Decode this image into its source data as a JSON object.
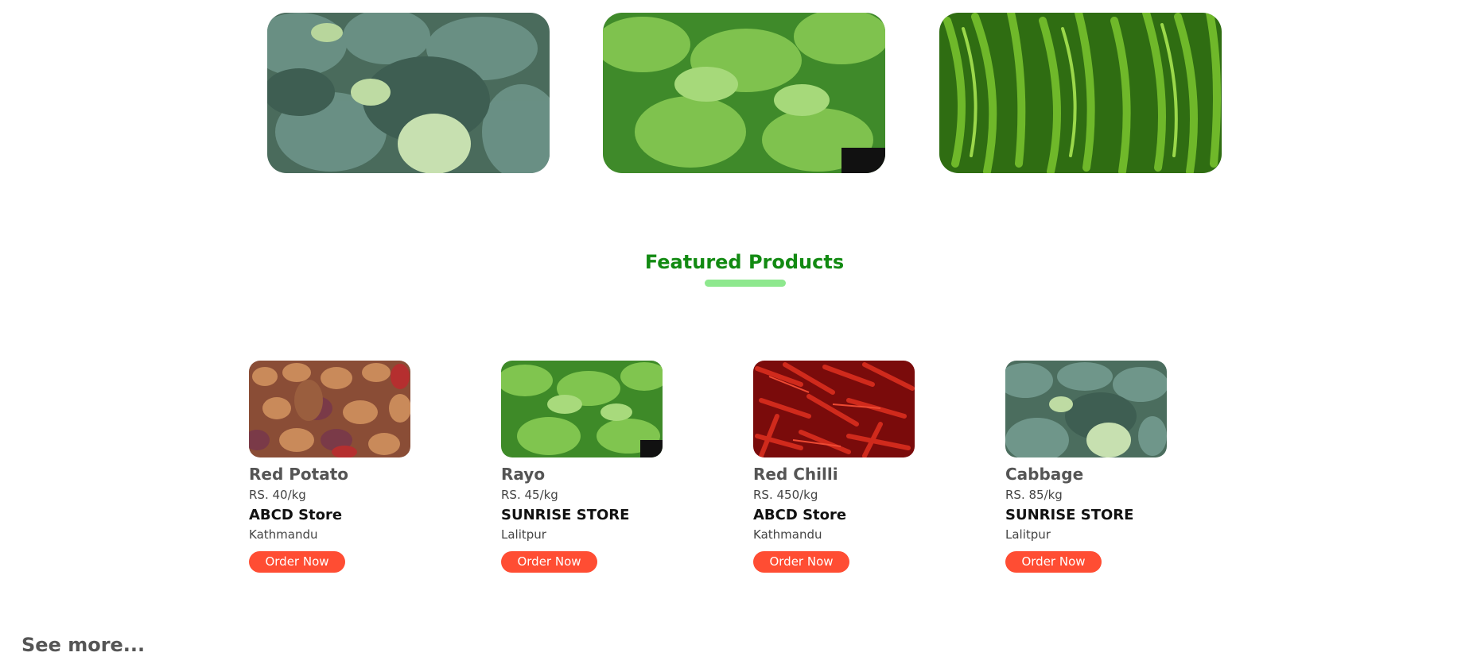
{
  "hero": [
    {
      "icon": "cabbage-field-image"
    },
    {
      "icon": "rayo-leaves-image"
    },
    {
      "icon": "green-chilli-image"
    }
  ],
  "featured": {
    "title": "Featured Products",
    "accent_color": "#128a12",
    "underline_color": "#8ee88e",
    "products": [
      {
        "name": "Red Potato",
        "price": "RS. 40/kg",
        "store": "ABCD Store",
        "location": "Kathmandu",
        "order_label": "Order Now",
        "icon": "red-potato-image"
      },
      {
        "name": "Rayo",
        "price": "RS. 45/kg",
        "store": "SUNRISE STORE",
        "location": "Lalitpur",
        "order_label": "Order Now",
        "icon": "rayo-image"
      },
      {
        "name": "Red Chilli",
        "price": "RS. 450/kg",
        "store": "ABCD Store",
        "location": "Kathmandu",
        "order_label": "Order Now",
        "icon": "red-chilli-image"
      },
      {
        "name": "Cabbage",
        "price": "RS. 85/kg",
        "store": "SUNRISE STORE",
        "location": "Lalitpur",
        "order_label": "Order Now",
        "icon": "cabbage-image"
      }
    ]
  },
  "see_more_label": "See more...",
  "button_color": "#ff4d33"
}
